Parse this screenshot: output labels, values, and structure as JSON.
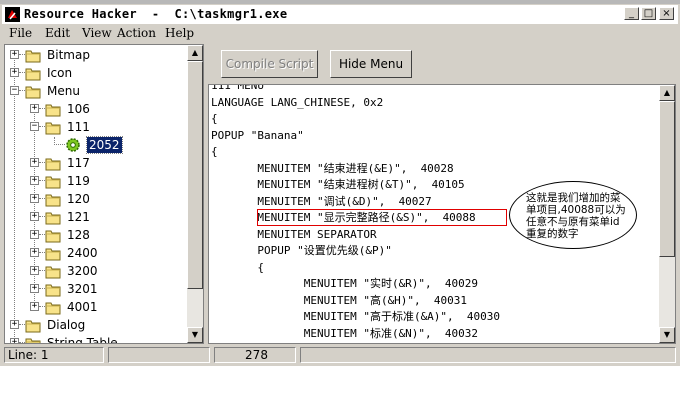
{
  "window": {
    "title": "Resource Hacker  -  C:\\taskmgr1.exe",
    "accent": "#0a246a"
  },
  "caption_buttons": {
    "minimize": "_",
    "maximize": "□",
    "close": "×"
  },
  "menu": [
    {
      "label": "File"
    },
    {
      "label": "Edit"
    },
    {
      "label": "View"
    },
    {
      "label": "Action"
    },
    {
      "label": "Help"
    }
  ],
  "toolbar": {
    "compile_label": "Compile Script",
    "hide_menu_label": "Hide Menu"
  },
  "tree": {
    "nodes": [
      {
        "label": "Bitmap",
        "level": 0,
        "expander": "+"
      },
      {
        "label": "Icon",
        "level": 0,
        "expander": "+"
      },
      {
        "label": "Menu",
        "level": 0,
        "expander": "−"
      },
      {
        "label": "106",
        "level": 1,
        "expander": "+"
      },
      {
        "label": "111",
        "level": 1,
        "expander": "−"
      },
      {
        "label": "2052",
        "level": 2,
        "expander": "",
        "selected": true
      },
      {
        "label": "117",
        "level": 1,
        "expander": "+"
      },
      {
        "label": "119",
        "level": 1,
        "expander": "+"
      },
      {
        "label": "120",
        "level": 1,
        "expander": "+"
      },
      {
        "label": "121",
        "level": 1,
        "expander": "+"
      },
      {
        "label": "128",
        "level": 1,
        "expander": "+"
      },
      {
        "label": "2400",
        "level": 1,
        "expander": "+"
      },
      {
        "label": "3200",
        "level": 1,
        "expander": "+"
      },
      {
        "label": "3201",
        "level": 1,
        "expander": "+"
      },
      {
        "label": "4001",
        "level": 1,
        "expander": "+"
      },
      {
        "label": "Dialog",
        "level": 0,
        "expander": "+"
      },
      {
        "label": "String Table",
        "level": 0,
        "expander": "+"
      }
    ]
  },
  "editor": {
    "lines": [
      "111 MENU",
      "LANGUAGE LANG_CHINESE, 0x2",
      "{",
      "POPUP \"Banana\"",
      "{",
      "       MENUITEM \"结束进程(&E)\",  40028",
      "       MENUITEM \"结束进程树(&T)\",  40105",
      "       MENUITEM \"调试(&D)\",  40027",
      "       MENUITEM \"显示完整路径(&S)\",  40088",
      "       MENUITEM SEPARATOR",
      "       POPUP \"设置优先级(&P)\"",
      "       {",
      "              MENUITEM \"实时(&R)\",  40029",
      "              MENUITEM \"高(&H)\",  40031",
      "              MENUITEM \"高于标准(&A)\",  40030",
      "              MENUITEM \"标准(&N)\",  40032"
    ],
    "annotation": "这就是我们增加的菜单项目,40088可以为任意不与原有菜单id重复的数字",
    "annotation_color": "#e00000"
  },
  "status": {
    "line": "Line: 1",
    "middle": "",
    "count": "278"
  }
}
